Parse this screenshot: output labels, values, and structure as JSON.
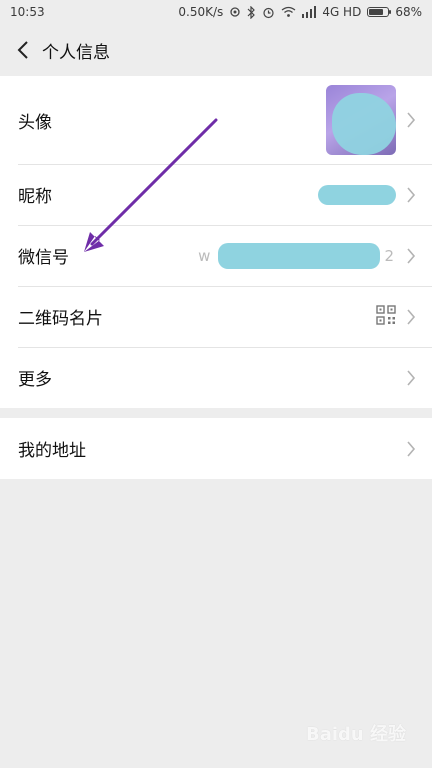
{
  "status_bar": {
    "time": "10:53",
    "net_speed": "0.50K/s",
    "network": "4G HD",
    "battery": "68%",
    "battery_level": 0.68
  },
  "header": {
    "title": "个人信息",
    "back_icon": "chevron-left-icon"
  },
  "profile": {
    "avatar_label": "头像",
    "nickname_label": "昵称",
    "wechat_id_label": "微信号",
    "wechat_id_prefix": "w",
    "wechat_id_suffix": "2",
    "qrcode_label": "二维码名片",
    "more_label": "更多"
  },
  "address": {
    "label": "我的地址"
  },
  "annotation": {
    "color": "#6f2da8"
  },
  "watermark": {
    "text": "Baidu 经验"
  },
  "colors": {
    "background": "#ededed",
    "row_background": "#ffffff",
    "redaction": "#8fd3e0",
    "chevron": "#b3b3b3"
  }
}
